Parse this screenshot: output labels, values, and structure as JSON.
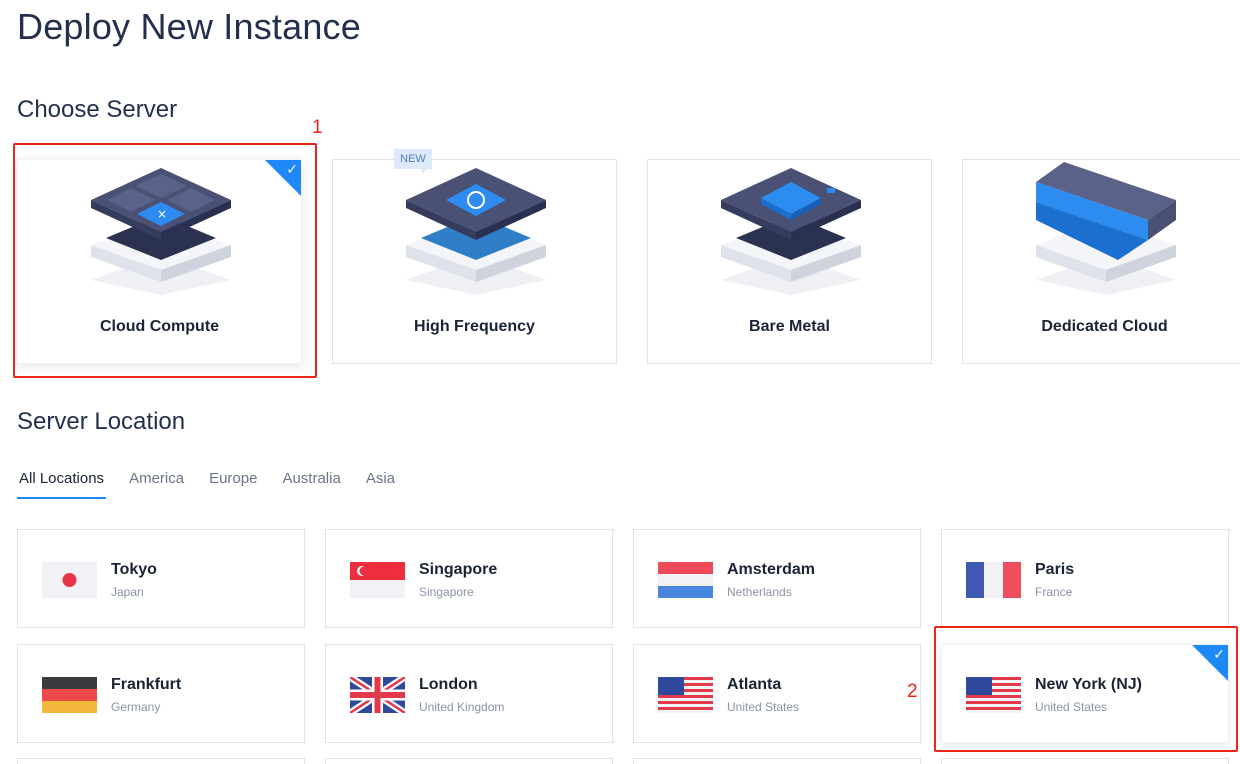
{
  "page": {
    "title": "Deploy New Instance"
  },
  "choose_server": {
    "title": "Choose Server",
    "cards": [
      {
        "label": "Cloud Compute",
        "selected": true
      },
      {
        "label": "High Frequency",
        "badge": "NEW",
        "selected": false
      },
      {
        "label": "Bare Metal",
        "selected": false
      },
      {
        "label": "Dedicated Cloud",
        "selected": false
      }
    ]
  },
  "server_location": {
    "title": "Server Location",
    "tabs": [
      "All Locations",
      "America",
      "Europe",
      "Australia",
      "Asia"
    ],
    "active_tab": "All Locations",
    "locations": [
      {
        "city": "Tokyo",
        "country": "Japan",
        "flag": "japan-flag"
      },
      {
        "city": "Singapore",
        "country": "Singapore",
        "flag": "singapore-flag"
      },
      {
        "city": "Amsterdam",
        "country": "Netherlands",
        "flag": "netherlands-flag"
      },
      {
        "city": "Paris",
        "country": "France",
        "flag": "france-flag"
      },
      {
        "city": "Frankfurt",
        "country": "Germany",
        "flag": "germany-flag"
      },
      {
        "city": "London",
        "country": "United Kingdom",
        "flag": "uk-flag"
      },
      {
        "city": "Atlanta",
        "country": "United States",
        "flag": "us-flag"
      },
      {
        "city": "New York (NJ)",
        "country": "United States",
        "flag": "us-flag",
        "selected": true
      }
    ]
  },
  "annotations": {
    "first": "1",
    "second": "2"
  },
  "colors": {
    "accent": "#1e88f7",
    "annotation": "#e8261c",
    "heading": "#23304d"
  },
  "icons": {
    "check": "✓"
  }
}
